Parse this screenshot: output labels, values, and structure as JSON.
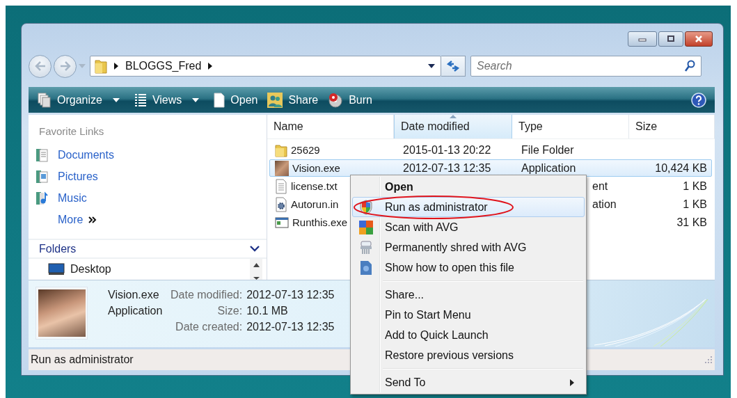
{
  "address_bar": {
    "breadcrumb": [
      "BLOGGS_Fred"
    ]
  },
  "search": {
    "placeholder": "Search"
  },
  "toolbar": {
    "buttons": [
      {
        "label": "Organize",
        "kind": "menu"
      },
      {
        "label": "Views",
        "kind": "menu"
      },
      {
        "label": "Open",
        "kind": "plain"
      },
      {
        "label": "Share",
        "kind": "plain"
      },
      {
        "label": "Burn",
        "kind": "plain"
      }
    ]
  },
  "sidebar": {
    "favorite_links": {
      "title": "Favorite Links",
      "items": [
        {
          "label": "Documents"
        },
        {
          "label": "Pictures"
        },
        {
          "label": "Music"
        }
      ],
      "more": "More"
    },
    "folders": {
      "title": "Folders",
      "expanded": true,
      "items": [
        {
          "label": "Desktop"
        }
      ]
    }
  },
  "file_list": {
    "columns": [
      {
        "label": "Name",
        "sorted": false
      },
      {
        "label": "Date modified",
        "sorted": true
      },
      {
        "label": "Type",
        "sorted": false
      },
      {
        "label": "Size",
        "sorted": false
      }
    ],
    "rows": [
      {
        "kind": "folder",
        "name": "25629",
        "date": "2015-01-13 20:22",
        "type": "File Folder",
        "type_cut_off": false,
        "selected": false
      },
      {
        "kind": "photo",
        "name": "Vision.exe",
        "date": "2012-07-13 12:35",
        "type": "Application",
        "type_cut_off": false,
        "size": "10,424 KB",
        "selected": true
      },
      {
        "kind": "text",
        "name": "license.txt",
        "type": "ent",
        "type_cut_off": true,
        "size": "1 KB",
        "selected": false
      },
      {
        "kind": "settings",
        "name": "Autorun.in",
        "type": "ation",
        "type_cut_off": true,
        "size": "1 KB",
        "selected": false
      },
      {
        "kind": "program",
        "name": "Runthis.exe",
        "size": "31 KB",
        "selected": false
      }
    ]
  },
  "details": {
    "name": "Vision.exe",
    "type": "Application",
    "fields": [
      {
        "label": "Date modified:",
        "value": "2012-07-13 12:35"
      },
      {
        "label": "Size:",
        "value": "10.1 MB"
      },
      {
        "label": "Date created:",
        "value": "2012-07-13 12:35"
      }
    ]
  },
  "status_bar": {
    "text": "Run as administrator"
  },
  "context_menu": {
    "items": [
      {
        "kind": "item",
        "label": "Open",
        "default": true,
        "selected": false,
        "submenu": false
      },
      {
        "kind": "item",
        "label": "Run as administrator",
        "default": false,
        "selected": true,
        "submenu": false
      },
      {
        "kind": "item",
        "label": "Scan with AVG",
        "default": false,
        "selected": false,
        "submenu": false
      },
      {
        "kind": "item",
        "label": "Permanently shred with AVG",
        "default": false,
        "selected": false,
        "submenu": false
      },
      {
        "kind": "item",
        "label": "Show how to open this file",
        "default": false,
        "selected": false,
        "submenu": false
      },
      {
        "kind": "separator"
      },
      {
        "kind": "item",
        "label": "Share...",
        "default": false,
        "selected": false,
        "submenu": false
      },
      {
        "kind": "item",
        "label": "Pin to Start Menu",
        "default": false,
        "selected": false,
        "submenu": false
      },
      {
        "kind": "item",
        "label": "Add to Quick Launch",
        "default": false,
        "selected": false,
        "submenu": false
      },
      {
        "kind": "item",
        "label": "Restore previous versions",
        "default": false,
        "selected": false,
        "submenu": false
      },
      {
        "kind": "separator"
      },
      {
        "kind": "item",
        "label": "Send To",
        "default": false,
        "selected": false,
        "submenu": true
      }
    ]
  }
}
